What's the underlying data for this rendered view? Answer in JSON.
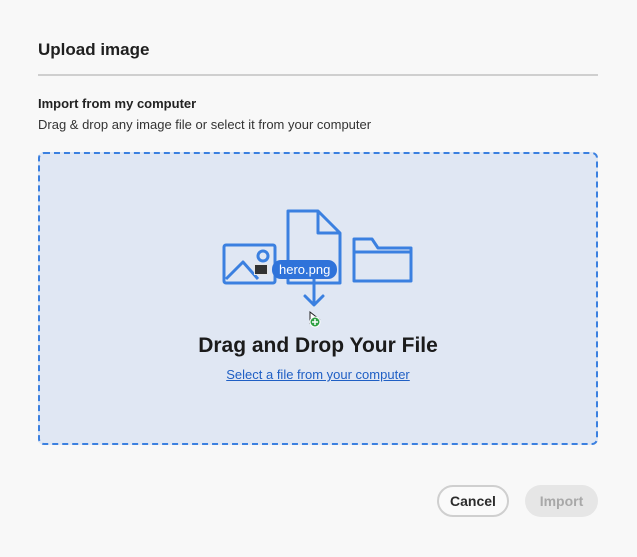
{
  "dialog": {
    "title": "Upload image",
    "section_heading": "Import from my computer",
    "section_description": "Drag & drop any image file or select it from your computer"
  },
  "dropzone": {
    "title": "Drag and Drop Your File",
    "select_link": "Select a file from your computer",
    "dragged_file": "hero.png",
    "icons": [
      "image-file-icon",
      "document-icon",
      "folder-icon",
      "download-arrow-icon",
      "cursor-copy-icon"
    ]
  },
  "actions": {
    "cancel_label": "Cancel",
    "import_label": "Import",
    "import_enabled": false
  },
  "colors": {
    "accent": "#3b80e0",
    "dropzone_bg": "#e0e7f3",
    "link": "#1f5fc4",
    "add_badge": "#2ea043"
  }
}
